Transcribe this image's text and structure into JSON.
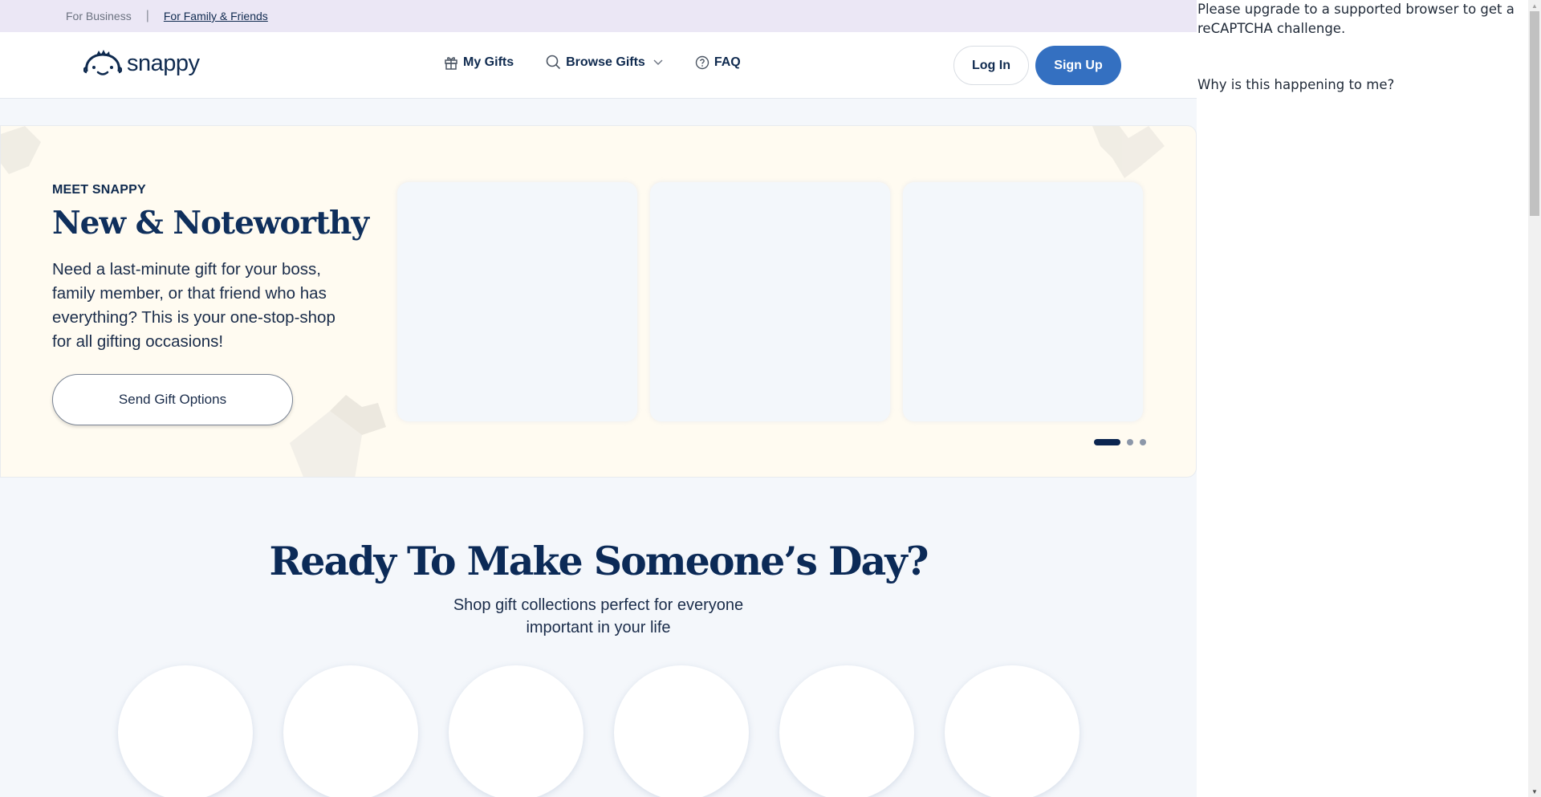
{
  "topbar": {
    "for_business": "For Business",
    "separator": "|",
    "for_family": "For Family & Friends"
  },
  "header": {
    "logo_text": "snappy",
    "nav": [
      {
        "label": "My Gifts",
        "icon": "gift-icon"
      },
      {
        "label": "Browse Gifts",
        "icon": "search-icon",
        "has_dropdown": true
      },
      {
        "label": "FAQ",
        "icon": "help-circle-icon"
      }
    ],
    "login_label": "Log In",
    "signup_label": "Sign Up",
    "accent_color": "#3470c1"
  },
  "hero": {
    "eyebrow": "MEET SNAPPY",
    "title": "New & Noteworthy",
    "description": "Need a last-minute gift for your boss, family member, or that friend who has everything? This is your one-stop-shop for all gifting occasions!",
    "cta_label": "Send Gift Options",
    "carousel": {
      "slide_count": 3,
      "active_index": 0
    }
  },
  "collections": {
    "title": "Ready To Make Someone’s Day?",
    "subtitle_line1": "Shop gift collections perfect for everyone",
    "subtitle_line2": "important in your life",
    "count": 6
  },
  "captcha": {
    "message": "Please upgrade to a supported browser to get a reCAPTCHA challenge.",
    "why_link": "Why is this happening to me?"
  }
}
